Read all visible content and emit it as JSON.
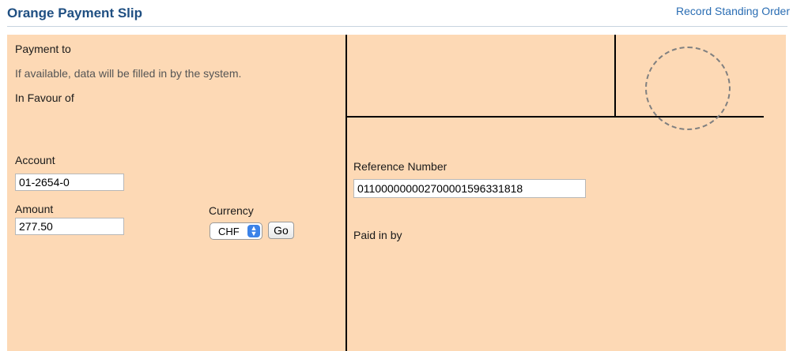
{
  "header": {
    "title": "Orange Payment Slip",
    "link": "Record Standing Order"
  },
  "left": {
    "payment_to_label": "Payment to",
    "hint": "If available, data will be filled in by the system.",
    "in_favour_label": "In Favour of",
    "account_label": "Account",
    "account_value": "01-2654-0",
    "amount_label": "Amount",
    "amount_value": "277.50",
    "currency_label": "Currency",
    "currency_selected": "CHF",
    "go_label": "Go"
  },
  "right": {
    "reference_label": "Reference Number",
    "reference_value": "011000000002700001596331818",
    "paid_in_by_label": "Paid in by"
  },
  "colors": {
    "slip_background": "#fdd9b5",
    "title": "#1f4f82",
    "link": "#2a6db3"
  }
}
